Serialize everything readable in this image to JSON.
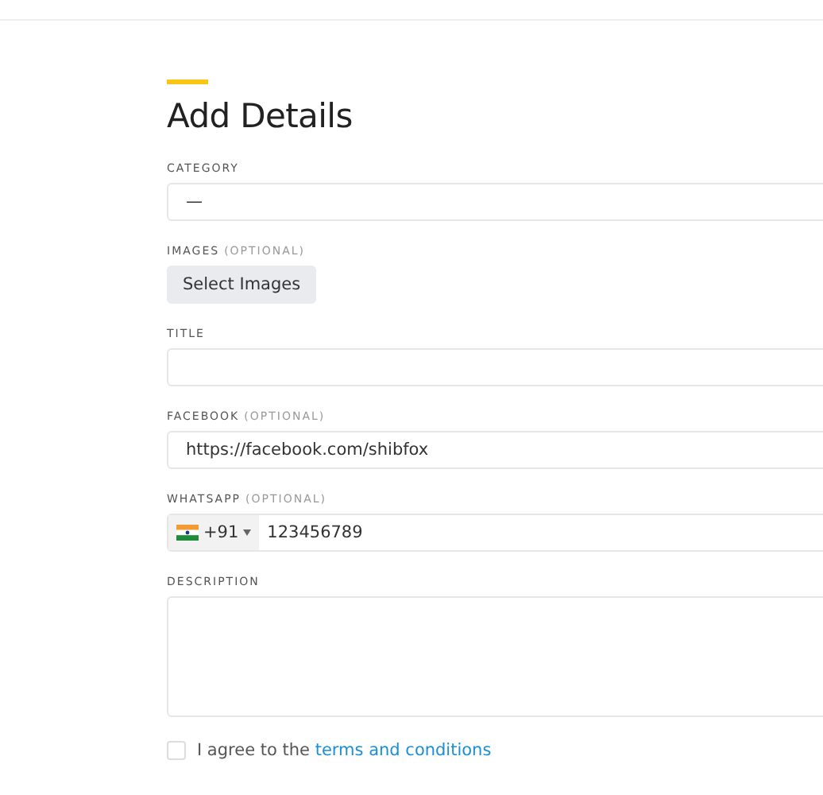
{
  "heading": "Add Details",
  "fields": [
    {
      "kind": "select",
      "label": "CATEGORY",
      "value": "—"
    },
    {
      "kind": "images",
      "label": "IMAGES",
      "note": "(OPTIONAL)",
      "button": "Select Images"
    },
    {
      "kind": "text",
      "label": "TITLE"
    },
    {
      "kind": "text",
      "label": "FACEBOOK",
      "note": "(OPTIONAL)",
      "value": "https://facebook.com/shibfox"
    },
    {
      "kind": "phone",
      "label": "WHATSAPP",
      "note": "(OPTIONAL)",
      "country_code": "+91",
      "value": "123456789"
    },
    {
      "kind": "textarea",
      "label": "DESCRIPTION"
    }
  ],
  "agreement": {
    "checked": false,
    "text": "I agree to the ",
    "link": "terms and conditions"
  }
}
